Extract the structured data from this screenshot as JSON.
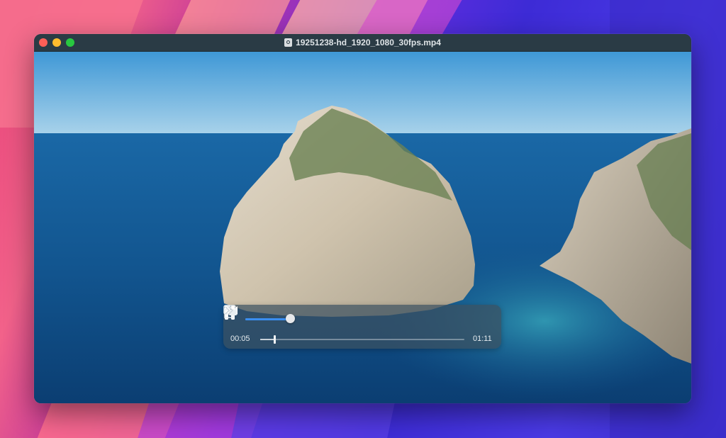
{
  "window": {
    "title": "19251238-hd_1920_1080_30fps.mp4"
  },
  "player": {
    "current_time": "00:05",
    "duration": "01:11",
    "playback_progress": 0.07,
    "volume_level": 0.96,
    "state": "playing"
  },
  "icons": {
    "file": "document-icon",
    "volume": "speaker-icon",
    "rewind": "rewind-icon",
    "pause": "pause-icon",
    "fast_forward": "fast-forward-icon",
    "pip": "picture-in-picture-icon",
    "share": "share-icon",
    "more": "double-chevron-right-icon"
  },
  "colors": {
    "accent": "#3a8ef0",
    "titlebar": "#2a3b45",
    "close": "#fe5f57",
    "minimize": "#febc2e",
    "maximize": "#28c840"
  }
}
